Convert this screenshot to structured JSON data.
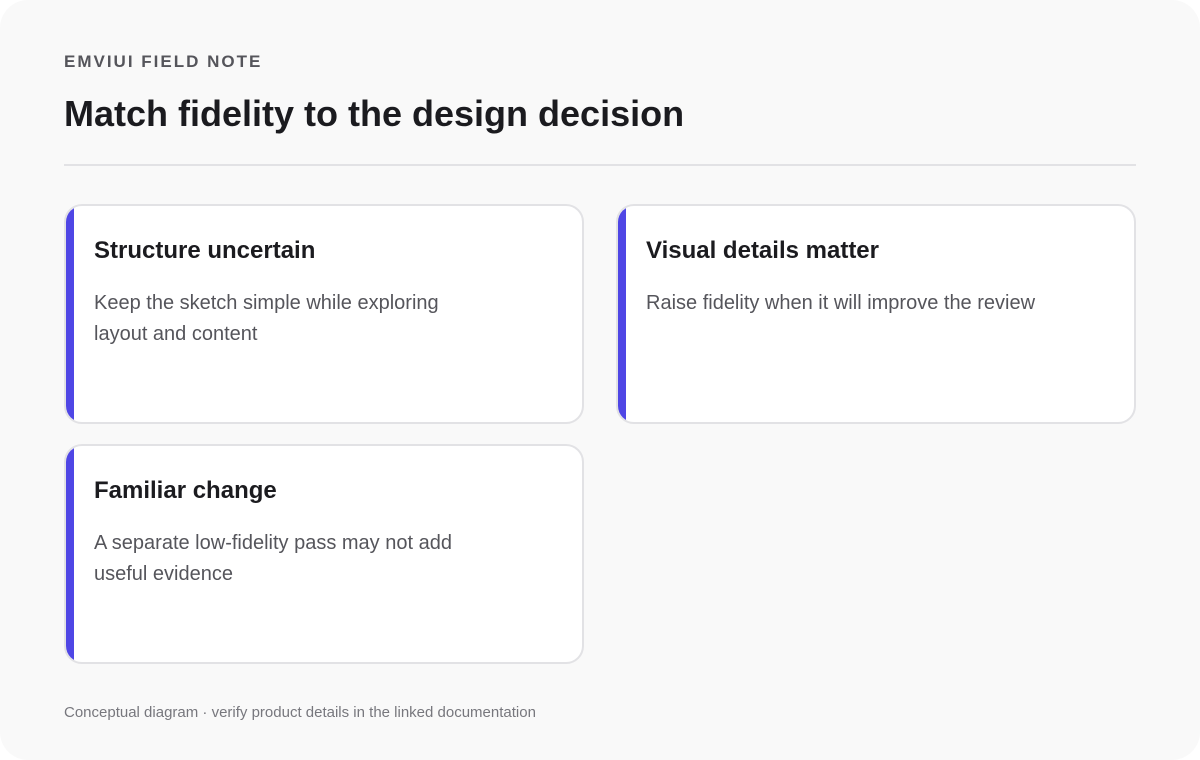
{
  "header": {
    "eyebrow": "EMVIUI FIELD NOTE",
    "title": "Match fidelity to the design decision"
  },
  "cards": [
    {
      "title": "Structure uncertain",
      "body": "Keep the sketch simple while exploring layout and content"
    },
    {
      "title": "Visual details matter",
      "body": "Raise fidelity when it will improve the review"
    },
    {
      "title": "Familiar change",
      "body": "A separate low-fidelity pass may not add useful evidence"
    }
  ],
  "footer": {
    "note": "Conceptual diagram · verify product details in the linked documentation"
  },
  "colors": {
    "accent": "#4f46e5",
    "background": "#f9f9f9",
    "card_background": "#ffffff",
    "border": "#e2e2e5",
    "text_primary": "#1b1b1f",
    "text_secondary": "#55555b",
    "text_muted": "#77777d"
  }
}
